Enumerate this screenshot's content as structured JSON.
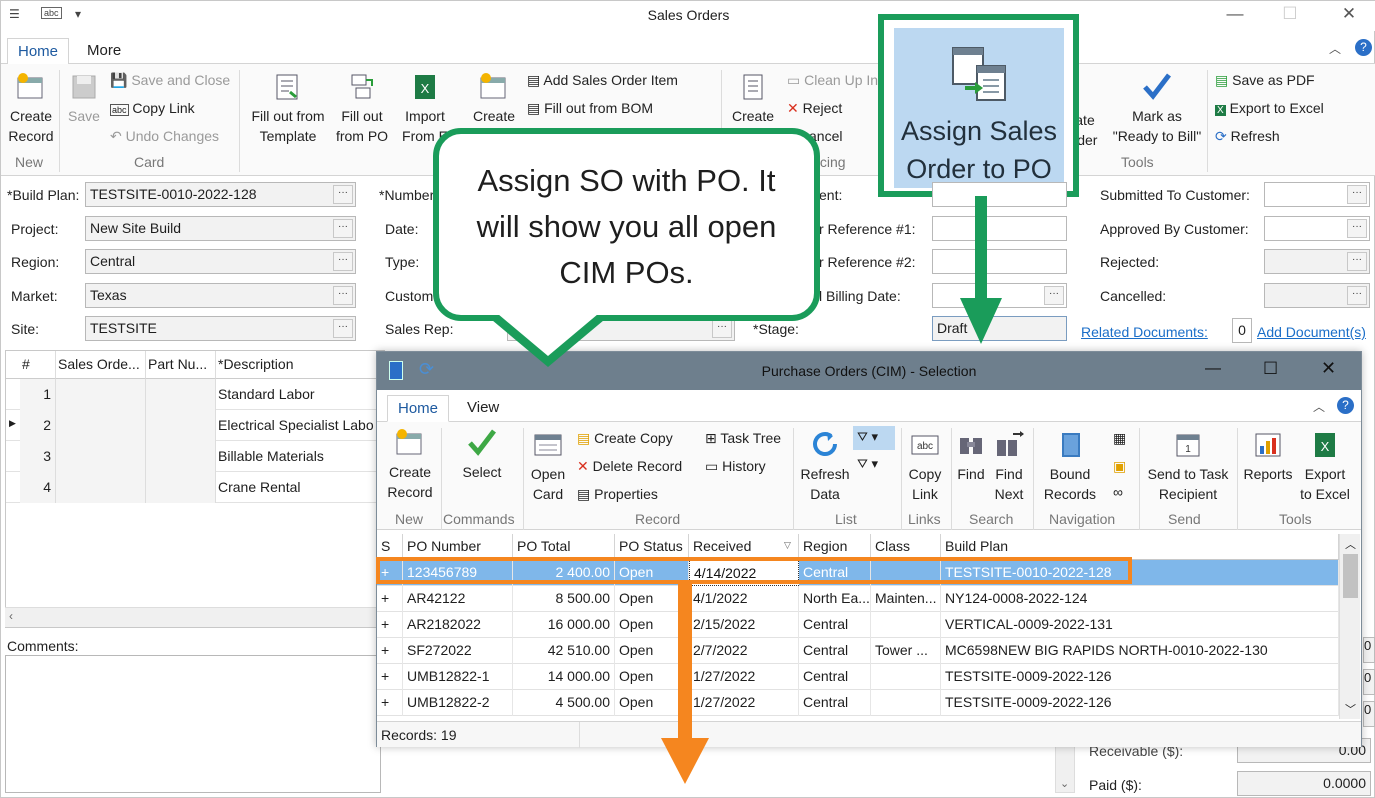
{
  "window": {
    "title": "Sales Orders"
  },
  "tabs": [
    "Home",
    "More"
  ],
  "ribbon": {
    "new": {
      "create_record": "Create\nRecord",
      "group": "New"
    },
    "card": {
      "save": "Save",
      "save_and_close": "Save and Close",
      "copy_link": "Copy Link",
      "undo_changes": "Undo Changes",
      "group": "Card"
    },
    "fill": {
      "fill_template": "Fill out from\nTemplate",
      "fill_po": "Fill out\nfrom PO",
      "import": "Import\nFrom E",
      "create": "Create",
      "add_item": "Add Sales Order Item",
      "fill_bom": "Fill out from BOM"
    },
    "invoicing": {
      "create": "Create",
      "clean_up": "Clean Up In",
      "reject": "Reject",
      "cancel": "ancel",
      "group": "oicing"
    },
    "assign": {
      "label": "Assign Sales\nOrder to PO"
    },
    "tools": {
      "create_order": "ate\nrder",
      "mark_ready": "Mark as\n\"Ready to Bill\"",
      "save_pdf": "Save as PDF",
      "export_excel": "Export to Excel",
      "refresh": "Refresh",
      "group": "Tools"
    }
  },
  "form": {
    "build_plan_label": "*Build Plan:",
    "build_plan": "TESTSITE-0010-2022-128",
    "project_label": "Project:",
    "project": "New Site Build",
    "region_label": "Region:",
    "region": "Central",
    "market_label": "Market:",
    "market": "Texas",
    "site_label": "Site:",
    "site": "TESTSITE",
    "number_label": "*Number",
    "date_label": "Date:",
    "type_label": "Type:",
    "customer_label": "Custom",
    "sales_rep_label": "Sales Rep:",
    "client_label": "ent:",
    "ref1_label": "r Reference #1:",
    "ref2_label": "r Reference #2:",
    "billing_date_label": "l Billing Date:",
    "stage_label": "*Stage:",
    "stage": "Draft",
    "submitted_label": "Submitted To Customer:",
    "approved_label": "Approved By Customer:",
    "rejected_label": "Rejected:",
    "cancelled_label": "Cancelled:",
    "related_docs": "Related Documents:",
    "related_count": "0",
    "add_docs": "Add Document(s)",
    "comments_label": "Comments:",
    "receivable_label": "Receivable ($):",
    "receivable": "0.00",
    "paid_label": "Paid ($):",
    "paid": "0.0000"
  },
  "items_grid": {
    "headers": [
      "#",
      "Sales Orde...",
      "Part Nu...",
      "*Description"
    ],
    "rows": [
      {
        "n": "1",
        "desc": "Standard Labor"
      },
      {
        "n": "2",
        "desc": "Electrical Specialist Labo"
      },
      {
        "n": "3",
        "desc": "Billable Materials"
      },
      {
        "n": "4",
        "desc": "Crane Rental"
      }
    ]
  },
  "callout": {
    "text": "Assign SO with PO. It will show you all open CIM POs."
  },
  "dialog": {
    "title": "Purchase Orders (CIM) - Selection",
    "tabs": [
      "Home",
      "View"
    ],
    "ribbon": {
      "create_record": "Create\nRecord",
      "new_group": "New",
      "select": "Select",
      "commands_group": "Commands",
      "open_card": "Open\nCard",
      "create_copy": "Create Copy",
      "delete_record": "Delete Record",
      "properties": "Properties",
      "task_tree": "Task Tree",
      "history": "History",
      "record_group": "Record",
      "refresh_data": "Refresh\nData",
      "list_group": "List",
      "copy_link": "Copy\nLink",
      "links_group": "Links",
      "find": "Find",
      "find_next": "Find\nNext",
      "search_group": "Search",
      "bound_records": "Bound\nRecords",
      "navigation_group": "Navigation",
      "send_to_task": "Send to Task\nRecipient",
      "send_group": "Send",
      "reports": "Reports",
      "export_excel": "Export\nto Excel",
      "tools_group": "Tools"
    },
    "columns": [
      "S",
      "PO Number",
      "PO Total",
      "PO Status",
      "Received",
      "Region",
      "Class",
      "Build Plan"
    ],
    "rows": [
      {
        "s": "+",
        "po": "123456789",
        "total": "2 400.00",
        "status": "Open",
        "received": "4/14/2022",
        "region": "Central",
        "class": "",
        "plan": "TESTSITE-0010-2022-128",
        "selected": true
      },
      {
        "s": "+",
        "po": "AR42122",
        "total": "8 500.00",
        "status": "Open",
        "received": "4/1/2022",
        "region": "North Ea...",
        "class": "Mainten...",
        "plan": "NY124-0008-2022-124"
      },
      {
        "s": "+",
        "po": "AR2182022",
        "total": "16 000.00",
        "status": "Open",
        "received": "2/15/2022",
        "region": "Central",
        "class": "",
        "plan": "VERTICAL-0009-2022-131"
      },
      {
        "s": "+",
        "po": "SF272022",
        "total": "42 510.00",
        "status": "Open",
        "received": "2/7/2022",
        "region": "Central",
        "class": "Tower ...",
        "plan": "MC6598NEW BIG RAPIDS NORTH-0010-2022-130"
      },
      {
        "s": "+",
        "po": "UMB12822-1",
        "total": "14 000.00",
        "status": "Open",
        "received": "1/27/2022",
        "region": "Central",
        "class": "",
        "plan": "TESTSITE-0009-2022-126"
      },
      {
        "s": "+",
        "po": "UMB12822-2",
        "total": "4 500.00",
        "status": "Open",
        "received": "1/27/2022",
        "region": "Central",
        "class": "",
        "plan": "TESTSITE-0009-2022-126"
      }
    ],
    "records": "Records: 19"
  },
  "colors": {
    "callout_green": "#1a9c5a",
    "highlight_orange": "#f5861f",
    "selected_row": "#7fb7ea"
  }
}
